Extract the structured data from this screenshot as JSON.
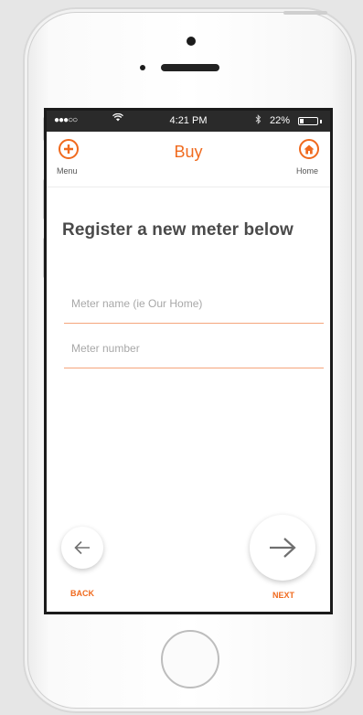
{
  "status_bar": {
    "signal": "●●●○○",
    "wifi_icon": "wifi-icon",
    "time": "4:21 PM",
    "bluetooth_icon": "bluetooth-icon",
    "battery_percent": "22%",
    "battery_level": 0.22
  },
  "header": {
    "title": "Buy",
    "menu_label": "Menu",
    "home_label": "Home",
    "menu_icon": "plus-circle-icon",
    "home_icon": "home-circle-icon"
  },
  "main": {
    "heading": "Register a new meter below",
    "fields": {
      "meter_name": {
        "value": "",
        "placeholder": "Meter name (ie Our Home)"
      },
      "meter_number": {
        "value": "",
        "placeholder": "Meter number"
      }
    }
  },
  "footer": {
    "back_label": "BACK",
    "next_label": "NEXT",
    "back_icon": "arrow-left-icon",
    "next_icon": "arrow-right-icon"
  },
  "colors": {
    "accent": "#f06a1e",
    "field_underline": "#f5a57c",
    "status_bar_bg": "#2a2a2a"
  }
}
